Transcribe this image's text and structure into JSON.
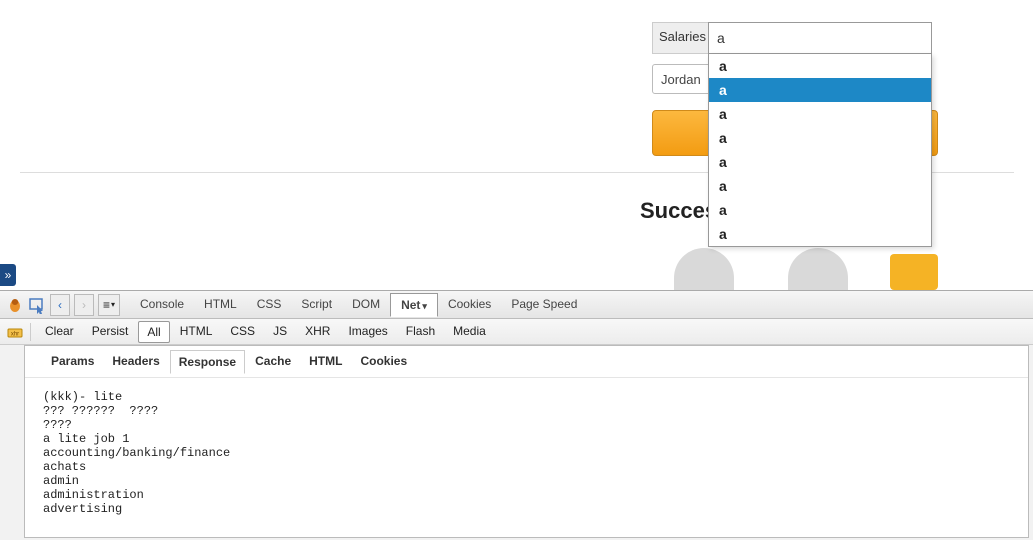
{
  "form": {
    "salaries_label": "Salaries",
    "search_value": "a",
    "jordan_value": "Jordan"
  },
  "heading": "Succes",
  "autocomplete": {
    "items": [
      "a",
      "a",
      "a",
      "a",
      "a",
      "a",
      "a",
      "a"
    ],
    "selected_index": 1
  },
  "side_tab_glyph": "»",
  "devtools": {
    "main_tabs": [
      "Console",
      "HTML",
      "CSS",
      "Script",
      "DOM",
      "Net",
      "Cookies",
      "Page Speed"
    ],
    "main_active": "Net",
    "filter_buttons": [
      "Clear",
      "Persist",
      "All",
      "HTML",
      "CSS",
      "JS",
      "XHR",
      "Images",
      "Flash",
      "Media"
    ],
    "filter_active": "All",
    "request_tabs": [
      "Params",
      "Headers",
      "Response",
      "Cache",
      "HTML",
      "Cookies"
    ],
    "request_active": "Response",
    "response_lines": [
      "(kkk)- lite",
      "??? ??????  ????",
      "????",
      "a lite job 1",
      "accounting/banking/finance",
      "achats",
      "admin",
      "administration",
      "advertising"
    ],
    "nav_caret": "▾",
    "menu_lines": "≡"
  }
}
